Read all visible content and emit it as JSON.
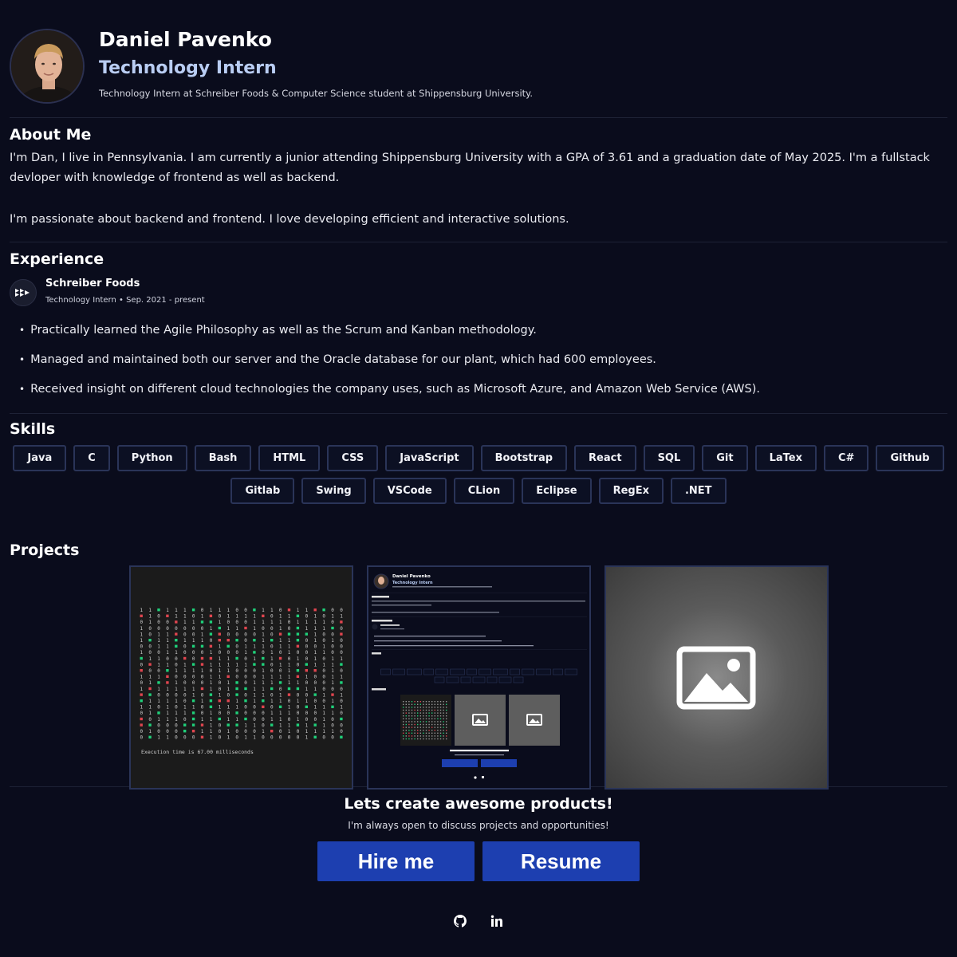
{
  "profile": {
    "name": "Daniel Pavenko",
    "role": "Technology Intern",
    "tagline": "Technology Intern at Schreiber Foods & Computer Science student at Shippensburg University."
  },
  "about": {
    "heading": "About Me",
    "p1": "I'm Dan, I live in Pennsylvania. I am currently a junior attending Shippensburg University with a GPA of 3.61 and a graduation date of May 2025. I'm a fullstack devloper with knowledge of frontend as well as backend.",
    "p2": "I'm passionate about backend and frontend. I love developing efficient and interactive solutions."
  },
  "experience": {
    "heading": "Experience",
    "company": "Schreiber Foods",
    "meta": "Technology Intern • Sep. 2021 - present",
    "bullets": [
      "Practically learned the Agile Philosophy as well as the Scrum and Kanban methodology.",
      "Managed and maintained both our server and the Oracle database for our plant, which had 600 employees.",
      "Received insight on different cloud technologies the company uses, such as Microsoft Azure, and Amazon Web Service (AWS)."
    ]
  },
  "skills": {
    "heading": "Skills",
    "items": [
      "Java",
      "C",
      "Python",
      "Bash",
      "HTML",
      "CSS",
      "JavaScript",
      "Bootstrap",
      "React",
      "SQL",
      "Git",
      "LaTex",
      "C#",
      "Github",
      "Gitlab",
      "Swing",
      "VSCode",
      "CLion",
      "Eclipse",
      "RegEx",
      ".NET"
    ]
  },
  "projects": {
    "heading": "Projects",
    "terminal_caption": "Execution time is 67.00 milliseconds",
    "preview": {
      "name": "Daniel Pavenko",
      "role": "Technology Intern"
    }
  },
  "cta": {
    "title": "Lets create awesome products!",
    "subtitle": "I'm always open to discuss projects and opportunities!",
    "hire_label": "Hire me",
    "resume_label": "Resume"
  },
  "colors": {
    "background": "#0a0c1c",
    "accent": "#1d3fb0",
    "role_text": "#b9cdf3",
    "chip_border": "#2a3458"
  }
}
